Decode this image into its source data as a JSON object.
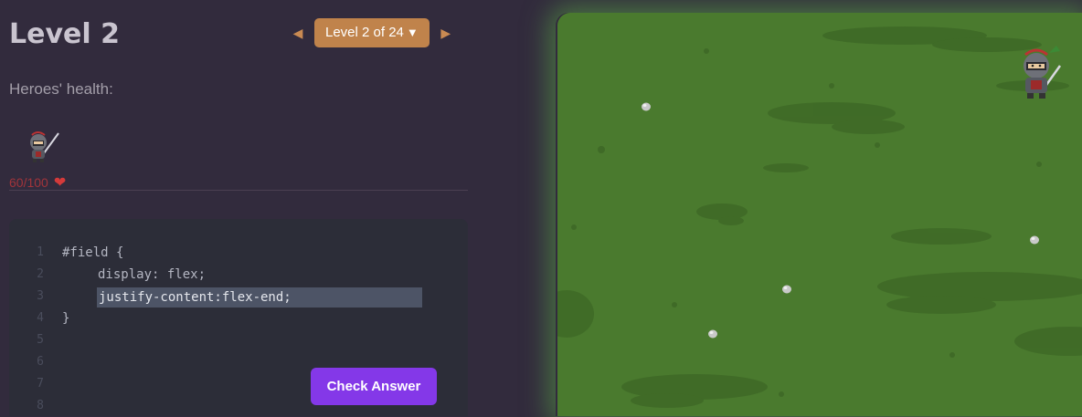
{
  "header": {
    "level_title": "Level 2",
    "level_selector_label": "Level 2 of 24",
    "level_selector_caret": "▼",
    "prev_arrow": "◀",
    "next_arrow": "▶"
  },
  "heroes": {
    "label": "Heroes' health:",
    "hero_icon": "knight-icon",
    "health": "60/100",
    "heart_icon": "heart-icon",
    "heart_glyph": "❤"
  },
  "editor": {
    "line_numbers": [
      "1",
      "2",
      "3",
      "4",
      "5",
      "6",
      "7",
      "8"
    ],
    "line1": "#field {",
    "line2": "display: flex;",
    "answer_value": "justify-content:flex-end;",
    "line4": "}"
  },
  "check_button_label": "Check Answer",
  "board": {
    "hero_icon": "knight-icon",
    "rock_icon": "rock-icon"
  },
  "colors": {
    "background": "#322b3d",
    "accent": "#c0834b",
    "button": "#8438e8",
    "grass": "#4a7a2e",
    "health_text": "#a1343b"
  }
}
